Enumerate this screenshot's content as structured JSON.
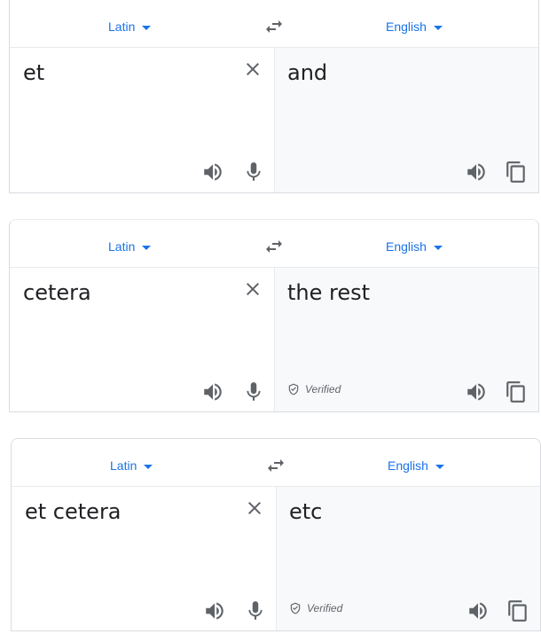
{
  "cards": [
    {
      "source_lang": "Latin",
      "target_lang": "English",
      "source_text": "et",
      "target_text": "and",
      "verified": ""
    },
    {
      "source_lang": "Latin",
      "target_lang": "English",
      "source_text": "cetera",
      "target_text": "the rest",
      "verified": "Verified"
    },
    {
      "source_lang": "Latin",
      "target_lang": "English",
      "source_text": "et cetera",
      "target_text": "etc",
      "verified": "Verified"
    }
  ],
  "icons": {
    "swap": "swap-horizontal-icon",
    "clear": "close-icon",
    "speak": "volume-icon",
    "mic": "microphone-icon",
    "copy": "copy-icon",
    "verified": "shield-check-icon"
  },
  "colors": {
    "accent": "#1a73e8",
    "icon": "#5f6368",
    "target_bg": "#f8f9fa",
    "border": "#dadce0"
  }
}
